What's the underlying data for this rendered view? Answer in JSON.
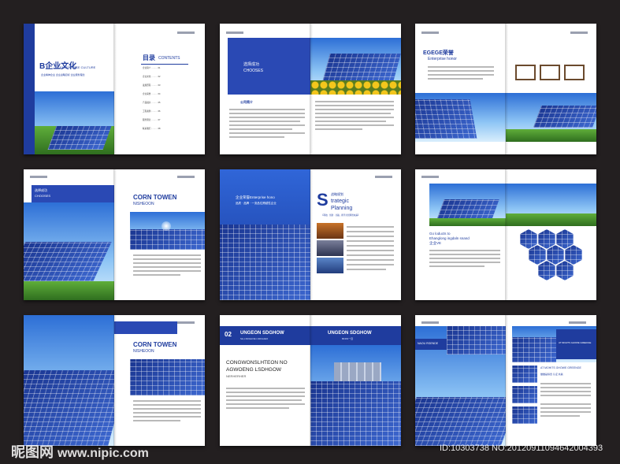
{
  "spreads": [
    {
      "left_title": "B企业文化",
      "left_sub": "ENTERPRISE CULTURE",
      "left_tag": "企业精神企业  企业战略目标  企业服务理念",
      "toc_title": "目录",
      "toc_en": "CONTENTS",
      "toc_items": [
        "企业简介 ……… 01",
        "企业文化 ……… 02",
        "发展历程 ……… 03",
        "企业荣誉 ……… 04",
        "产品展示 ……… 05",
        "工程案例 ……… 06",
        "服务理念 ……… 07",
        "联系我们 ……… 08"
      ]
    },
    {
      "heading_en": "CHOOSES",
      "heading_cn": "选择成功",
      "section": "公司简介"
    },
    {
      "title_cn": "EGEGE荣誉",
      "title_en": "Enterprise honor"
    },
    {
      "heading_cn": "选择成功",
      "heading_en": "CHOOSES",
      "title1": "CORN TOWEN",
      "title2": "NISHEOON"
    },
    {
      "line1": "企业荣誉Enterprise hono",
      "line2": "品质 · 品牌 · 一流品位跨越性企业",
      "title_cn": "战略规划",
      "title_en1": "trategic",
      "title_en2": "Planning",
      "slogan": "【科技 · 创新 · 共赢，携手共创辉煌未来】"
    },
    {
      "title1": "Go loducts to",
      "title2": "Ehanglong ingdaln snand",
      "title3": "企业VE"
    },
    {
      "title1": "CORN TOWEN",
      "title2": "NISHEOON"
    },
    {
      "num": "02",
      "bar_left": "UNGEON SDGHOW",
      "bar_sub": "SH,LSDGHOE LSDGHEO",
      "bar_right": "UNGEON SDGHOW",
      "bar_right_sub": "BFDN一目",
      "heading1": "CONGWONSLHTEON NO",
      "heading2": "AGWOENG LSDHGOW",
      "heading3": "NERHERHER"
    },
    {
      "label_left": "NAOU RGENDE",
      "label_right": "AT MOHITS GHOWE GREENGE",
      "sub_title": "AT MOHITS GHOWE GREENGE",
      "sub_cn": "做做是综合 认证 共赢"
    }
  ],
  "watermark": {
    "site_cn": "昵图网",
    "site_url": "www.nipic.com",
    "id_text": "ID:10303738 NO:20120911094642004393"
  }
}
